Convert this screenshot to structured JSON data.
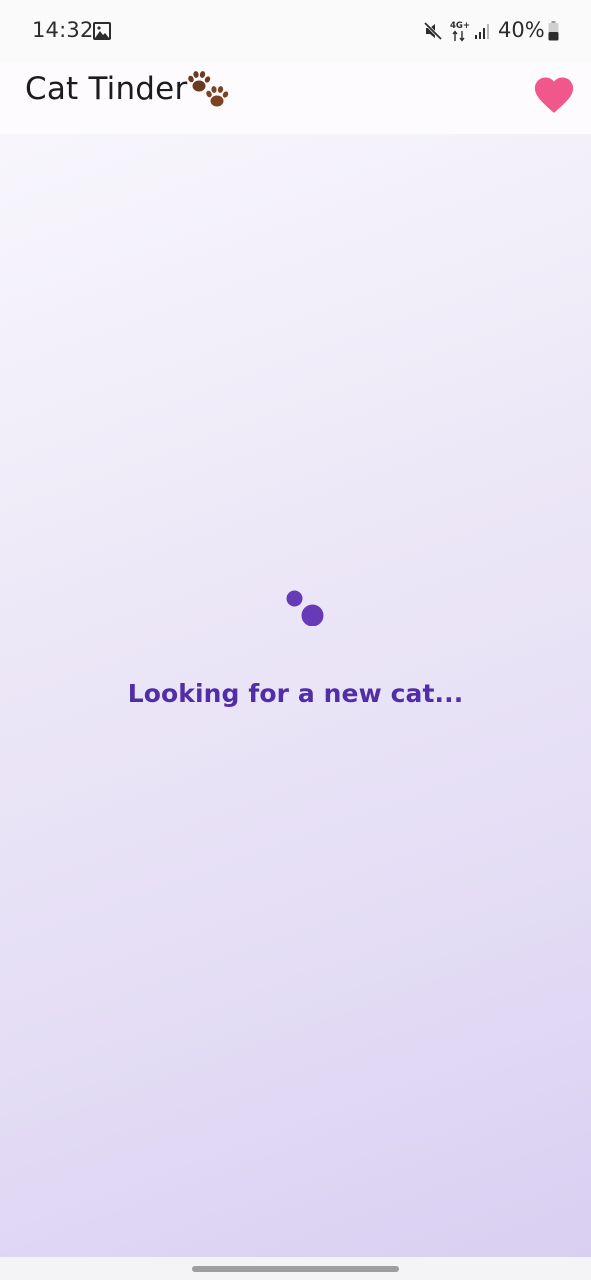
{
  "status_bar": {
    "time": "14:32",
    "battery_percent": "40%",
    "network_label": "4G+",
    "icons": [
      "gallery-icon",
      "mute-icon",
      "network-4g-icon",
      "signal-icon",
      "battery-icon"
    ]
  },
  "app_bar": {
    "title": "Cat Tinder",
    "title_emoji": "paw-prints-icon",
    "favorites_icon": "heart-icon"
  },
  "content": {
    "loading_text": "Looking for a new cat..."
  },
  "colors": {
    "accent": "#512da8",
    "loader": "#673ab7",
    "heart": "#f0578a",
    "paw": "#6b3a1f"
  }
}
